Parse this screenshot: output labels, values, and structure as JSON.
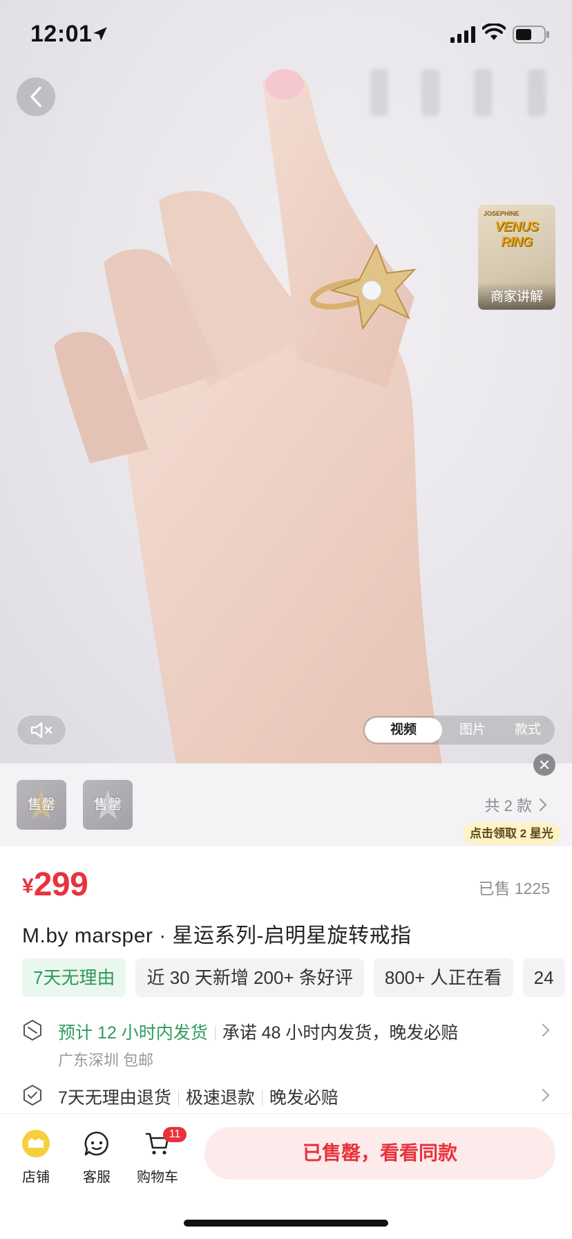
{
  "status_bar": {
    "time": "12:01"
  },
  "media": {
    "merchant_card": {
      "brand": "JOSEPHINE",
      "title": "VENUS RING",
      "label": "商家讲解"
    },
    "tabs": [
      {
        "label": "视频"
      },
      {
        "label": "图片"
      },
      {
        "label": "款式"
      }
    ],
    "active_tab": "视频"
  },
  "variants": {
    "items": [
      {
        "label": "售罄"
      },
      {
        "label": "售罄"
      }
    ],
    "total_label": "共 2 款",
    "starlight_badge": "点击领取 2 星光"
  },
  "product": {
    "currency": "¥",
    "price": "299",
    "sold": "已售 1225",
    "title": "M.by marsper · 星运系列-启明星旋转戒指",
    "tags": [
      {
        "label": "7天无理由",
        "style": "green"
      },
      {
        "label": "近 30 天新增 200+ 条好评"
      },
      {
        "label": "800+ 人正在看"
      },
      {
        "label": "24"
      }
    ]
  },
  "services": {
    "shipping": {
      "highlight": "预计 12 小时内发货",
      "promise": "承诺 48 小时内发货，晚发必赔",
      "origin": "广东深圳 包邮"
    },
    "returns": {
      "items": [
        "7天无理由退货",
        "极速退款",
        "晚发必赔"
      ]
    }
  },
  "bottom_bar": {
    "store_label": "店铺",
    "service_label": "客服",
    "cart_label": "购物车",
    "cart_count": "11",
    "cta_label": "已售罄，看看同款"
  },
  "colors": {
    "price_red": "#e8323c",
    "service_green": "#2f9a5c",
    "cta_bg": "#fdebec",
    "badge_yellow": "#fdf3c6"
  }
}
